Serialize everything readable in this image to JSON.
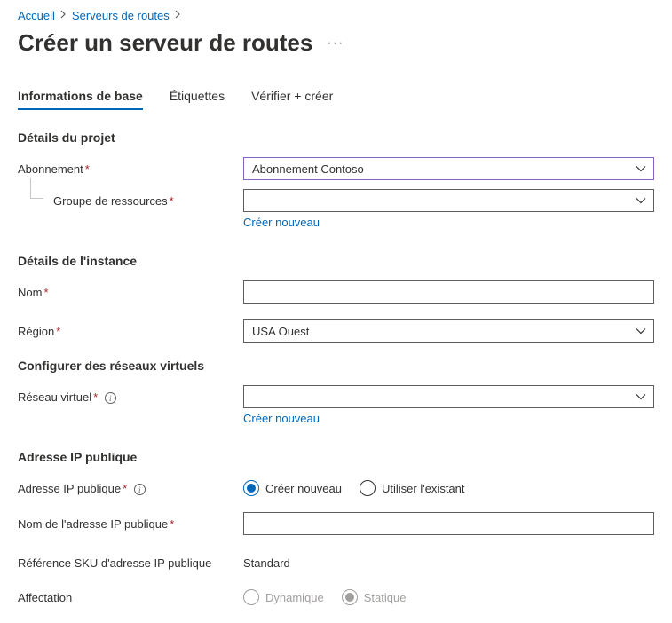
{
  "breadcrumb": {
    "home": "Accueil",
    "parent": "Serveurs de routes"
  },
  "pageTitle": "Créer un serveur de routes",
  "tabs": {
    "basics": "Informations de base",
    "tags": "Étiquettes",
    "review": "Vérifier + créer"
  },
  "sections": {
    "projectDetails": "Détails du projet",
    "instanceDetails": "Détails de l'instance",
    "configureVnet": "Configurer des réseaux virtuels",
    "publicIp": "Adresse IP publique"
  },
  "labels": {
    "subscription": "Abonnement",
    "resourceGroup": "Groupe de ressources",
    "name": "Nom",
    "region": "Région",
    "vnet": "Réseau virtuel",
    "publicIp": "Adresse IP publique",
    "publicIpName": "Nom de l'adresse IP publique",
    "publicIpSku": "Référence SKU d'adresse IP publique",
    "assignment": "Affectation"
  },
  "values": {
    "subscription": "Abonnement Contoso",
    "resourceGroup": "",
    "name": "",
    "region": "USA Ouest",
    "vnet": "",
    "publicIpName": "",
    "publicIpSku": "Standard"
  },
  "links": {
    "createNew": "Créer nouveau"
  },
  "radio": {
    "createNew": "Créer nouveau",
    "useExisting": "Utiliser l'existant",
    "dynamic": "Dynamique",
    "static": "Statique"
  }
}
